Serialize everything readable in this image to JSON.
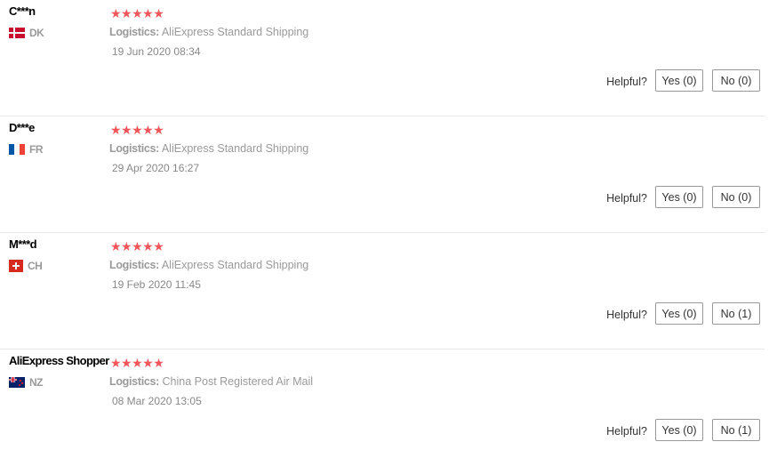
{
  "reviews": [
    {
      "name": "C***n",
      "country": "DK",
      "stars": "★★★★★",
      "logistics_label": "Logistics:",
      "logistics": "AliExpress Standard Shipping",
      "date": "19 Jun 2020 08:34",
      "helpful_label": "Helpful?",
      "yes": "Yes (0)",
      "no": "No (0)"
    },
    {
      "name": "D***e",
      "country": "FR",
      "stars": "★★★★★",
      "logistics_label": "Logistics:",
      "logistics": "AliExpress Standard Shipping",
      "date": "29 Apr 2020 16:27",
      "helpful_label": "Helpful?",
      "yes": "Yes (0)",
      "no": "No (0)"
    },
    {
      "name": "M***d",
      "country": "CH",
      "stars": "★★★★★",
      "logistics_label": "Logistics:",
      "logistics": "AliExpress Standard Shipping",
      "date": "19 Feb 2020 11:45",
      "helpful_label": "Helpful?",
      "yes": "Yes (0)",
      "no": "No (1)"
    },
    {
      "name": "AliExpress Shopper",
      "country": "NZ",
      "stars": "★★★★★",
      "logistics_label": "Logistics:",
      "logistics": "China Post Registered Air Mail",
      "date": "08 Mar 2020 13:05",
      "helpful_label": "Helpful?",
      "yes": "Yes (0)",
      "no": "No (1)"
    }
  ],
  "colors": {
    "star": "#f0565a",
    "muted": "#9a9a9a",
    "divider": "#e8e8e8"
  },
  "flags": [
    "dk-flag-icon",
    "fr-flag-icon",
    "ch-flag-icon",
    "nz-flag-icon"
  ]
}
